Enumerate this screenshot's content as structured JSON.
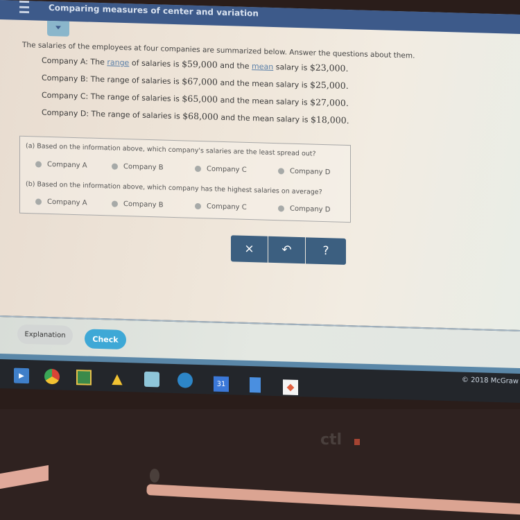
{
  "header": {
    "topic_title": "Comparing measures of center and variation"
  },
  "problem": {
    "intro": "The salaries of the employees at four companies are summarized below. Answer the questions about them.",
    "facts": [
      {
        "company": "Company A",
        "pre": "The ",
        "range_word": "range",
        "mid": " of salaries is ",
        "range": "$59,000",
        "and": " and the ",
        "mean_word": "mean",
        "post": " salary is ",
        "mean": "$23,000",
        "end": "."
      },
      {
        "company": "Company B",
        "pre": "The ",
        "range_word": "range",
        "mid": " of salaries is ",
        "range": "$67,000",
        "and": " and the ",
        "mean_word": "mean",
        "post": " salary is ",
        "mean": "$25,000",
        "end": "."
      },
      {
        "company": "Company C",
        "pre": "The ",
        "range_word": "range",
        "mid": " of salaries is ",
        "range": "$65,000",
        "and": " and the ",
        "mean_word": "mean",
        "post": " salary is ",
        "mean": "$27,000",
        "end": "."
      },
      {
        "company": "Company D",
        "pre": "The ",
        "range_word": "range",
        "mid": " of salaries is ",
        "range": "$68,000",
        "and": " and the ",
        "mean_word": "mean",
        "post": " salary is ",
        "mean": "$18,000",
        "end": "."
      }
    ]
  },
  "questions": [
    {
      "text": "(a) Based on the information above, which company's salaries are the least spread out?",
      "options": [
        "Company A",
        "Company B",
        "Company C",
        "Company D"
      ],
      "selected": null
    },
    {
      "text": "(b) Based on the information above, which company has the highest salaries on average?",
      "options": [
        "Company A",
        "Company B",
        "Company C",
        "Company D"
      ],
      "selected": null
    }
  ],
  "toolbar": {
    "clear": "×",
    "undo": "↶",
    "help": "?"
  },
  "footer": {
    "explanation_label": "Explanation",
    "check_label": "Check"
  },
  "shelf": {
    "copyright": "© 2018 McGraw",
    "calendar_day": "31"
  },
  "bezel": {
    "logo": "ctl"
  }
}
